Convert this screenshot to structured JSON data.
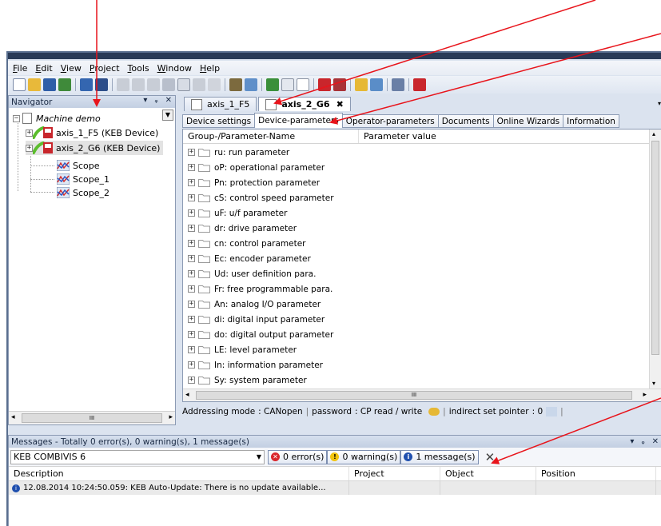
{
  "menu": [
    {
      "pre": "",
      "u": "F",
      "post": "ile"
    },
    {
      "pre": "",
      "u": "E",
      "post": "dit"
    },
    {
      "pre": "",
      "u": "V",
      "post": "iew"
    },
    {
      "pre": "",
      "u": "P",
      "post": "roject"
    },
    {
      "pre": "",
      "u": "T",
      "post": "ools"
    },
    {
      "pre": "",
      "u": "W",
      "post": "indow"
    },
    {
      "pre": "",
      "u": "H",
      "post": "elp"
    }
  ],
  "navigator": {
    "title": "Navigator",
    "root": "Machine demo",
    "items": [
      "axis_1_F5 (KEB Device)",
      "axis_2_G6 (KEB Device)",
      "Scope",
      "Scope_1",
      "Scope_2"
    ],
    "hscroll_label": "III"
  },
  "doc_tabs": [
    "axis_1_F5",
    "axis_2_G6"
  ],
  "sub_tabs": [
    "Device settings",
    "Device-parameters",
    "Operator-parameters",
    "Documents",
    "Online Wizards",
    "Information"
  ],
  "grid": {
    "col1": "Group-/Parameter-Name",
    "col2": "Parameter value",
    "rows": [
      "ru: run parameter",
      "oP: operational parameter",
      "Pn: protection parameter",
      "cS: control speed parameter",
      "uF: u/f parameter",
      "dr: drive parameter",
      "cn: control parameter",
      "Ec: encoder parameter",
      "Ud: user definition para.",
      "Fr: free programmable para.",
      "An: analog I/O parameter",
      "di: digital input parameter",
      "do: digital output parameter",
      "LE: level parameter",
      "In: information parameter",
      "Sy: system parameter"
    ],
    "hscroll_label": "III"
  },
  "status": {
    "addressing_label": "Addressing mode",
    "addressing_value": ": CANopen",
    "password_label": "password",
    "password_value": ": CP read / write",
    "pointer_label": "indirect set pointer",
    "pointer_value": ": 0"
  },
  "messages": {
    "title": "Messages - Totally 0 error(s), 0 warning(s), 1 message(s)",
    "source": "KEB COMBIVIS 6",
    "errors": "0 error(s)",
    "warnings": "0 warning(s)",
    "infos": "1 message(s)",
    "columns": [
      "Description",
      "Project",
      "Object",
      "Position"
    ],
    "row": "12.08.2014 10:24:50.059:  KEB Auto-Update: There is no update available..."
  },
  "colors": {
    "annotation": "#e8141b",
    "error": "#d9262c",
    "warning": "#f2c40f",
    "info": "#1f4fae"
  }
}
